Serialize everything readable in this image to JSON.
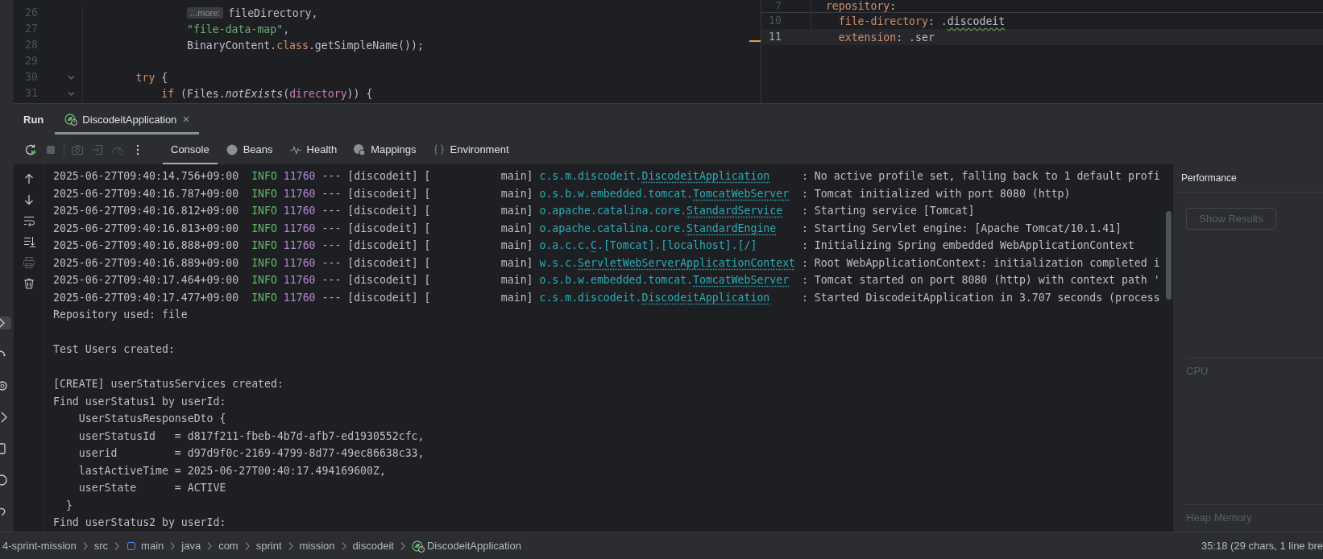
{
  "tool_strip": [
    {
      "selected": true
    },
    {
      "selected": false
    },
    {
      "selected": false
    },
    {
      "selected": false
    },
    {
      "selected": false
    },
    {
      "selected": false
    },
    {
      "selected": false
    }
  ],
  "editor_left": {
    "lines": [
      {
        "number": "26",
        "foldable": false,
        "hint": "...more:",
        "tokens": [
          {
            "kind": "plain",
            "text": "                fileDirectory,"
          }
        ]
      },
      {
        "number": "27",
        "foldable": false,
        "tokens": [
          {
            "kind": "string",
            "text": "                \"file-data-map\""
          },
          {
            "kind": "plain",
            "text": ","
          }
        ]
      },
      {
        "number": "28",
        "foldable": false,
        "tokens": [
          {
            "kind": "plain",
            "text": "                BinaryContent."
          },
          {
            "kind": "keyword",
            "text": "class"
          },
          {
            "kind": "plain",
            "text": ".getSimpleName());"
          }
        ]
      },
      {
        "number": "29",
        "foldable": false
      },
      {
        "number": "30",
        "foldable": true,
        "tokens": [
          {
            "kind": "keyword",
            "text": "        try"
          },
          {
            "kind": "plain",
            "text": " {"
          }
        ]
      },
      {
        "number": "31",
        "foldable": true,
        "tokens": [
          {
            "kind": "keyword",
            "text": "            if"
          },
          {
            "kind": "plain",
            "text": " (Files."
          },
          {
            "kind": "method",
            "text": "notExists"
          },
          {
            "kind": "plain",
            "text": "("
          },
          {
            "kind": "field",
            "text": "directory"
          },
          {
            "kind": "plain",
            "text": ")) {"
          }
        ]
      }
    ]
  },
  "editor_right": {
    "lines": [
      {
        "number": "7",
        "sticky": true,
        "current": false,
        "tokens": [
          {
            "kind": "key",
            "text": "  repository"
          },
          {
            "kind": "plain",
            "text": ":"
          }
        ]
      },
      {
        "number": "10",
        "sticky": false,
        "current": false,
        "tokens": [
          {
            "kind": "key",
            "text": "    file-directory"
          },
          {
            "kind": "plain",
            "text": ": ."
          },
          {
            "kind": "typo",
            "text": "discodeit"
          }
        ]
      },
      {
        "number": "11",
        "sticky": false,
        "current": true,
        "tokens": [
          {
            "kind": "key",
            "text": "    extension"
          },
          {
            "kind": "plain",
            "text": ": .ser"
          }
        ]
      }
    ]
  },
  "run": {
    "title": "Run",
    "tabs": [
      {
        "label": "DiscodeitApplication",
        "selected": true
      }
    ],
    "toolbar_groups": [
      {
        "items": [
          {
            "kind": "rerun",
            "disabled": false
          },
          {
            "kind": "stop",
            "disabled": true
          }
        ]
      },
      {
        "items": [
          {
            "kind": "camera",
            "disabled": true
          },
          {
            "kind": "login",
            "disabled": true
          },
          {
            "kind": "gauge",
            "disabled": true
          },
          {
            "kind": "more",
            "disabled": false
          }
        ]
      }
    ],
    "views": [
      {
        "label": "Console",
        "selected": true
      },
      {
        "label": "Beans",
        "kind": "beans",
        "selected": false
      },
      {
        "label": "Health",
        "kind": "health",
        "selected": false
      },
      {
        "label": "Mappings",
        "kind": "mappings",
        "selected": false
      },
      {
        "label": "Environment",
        "kind": "environment",
        "selected": false
      }
    ]
  },
  "console": {
    "side_tools": [
      {
        "kind": "up",
        "disabled": false
      },
      {
        "kind": "down",
        "disabled": false
      },
      {
        "kind": "wrap",
        "disabled": false
      },
      {
        "kind": "scroll_end",
        "disabled": false
      },
      {
        "kind": "print",
        "disabled": true
      },
      {
        "kind": "trash",
        "disabled": false
      }
    ],
    "lines": [
      {
        "kind": "log",
        "timestamp": "2025-06-27T09:40:14.756+09:00",
        "level": "INFO",
        "pid": "11760",
        "context": "--- [discodeit] [           main]",
        "logger_prefix": "c.s.m.discodeit.",
        "logger_class": "DiscodeitApplication",
        "message": ": No active profile set, falling back to 1 default profi"
      },
      {
        "kind": "log",
        "timestamp": "2025-06-27T09:40:16.787+09:00",
        "level": "INFO",
        "pid": "11760",
        "context": "--- [discodeit] [           main]",
        "logger_prefix": "o.s.b.w.embedded.tomcat.",
        "logger_class": "TomcatWebServer",
        "message": ": Tomcat initialized with port 8080 (http)"
      },
      {
        "kind": "log",
        "timestamp": "2025-06-27T09:40:16.812+09:00",
        "level": "INFO",
        "pid": "11760",
        "context": "--- [discodeit] [           main]",
        "logger_prefix": "o.apache.catalina.core.",
        "logger_class": "StandardService",
        "message": ": Starting service [Tomcat]"
      },
      {
        "kind": "log",
        "timestamp": "2025-06-27T09:40:16.813+09:00",
        "level": "INFO",
        "pid": "11760",
        "context": "--- [discodeit] [           main]",
        "logger_prefix": "o.apache.catalina.core.",
        "logger_class": "StandardEngine",
        "message": ": Starting Servlet engine: [Apache Tomcat/10.1.41]"
      },
      {
        "kind": "log",
        "timestamp": "2025-06-27T09:40:16.888+09:00",
        "level": "INFO",
        "pid": "11760",
        "context": "--- [discodeit] [           main]",
        "logger_prefix": "o.a.c.c.",
        "logger_class": "C",
        "logger_suffix": ".[Tomcat].[localhost].[/]",
        "message": ": Initializing Spring embedded WebApplicationContext"
      },
      {
        "kind": "log",
        "timestamp": "2025-06-27T09:40:16.889+09:00",
        "level": "INFO",
        "pid": "11760",
        "context": "--- [discodeit] [           main]",
        "logger_prefix": "w.s.c.",
        "logger_class": "ServletWebServerApplicationContext",
        "message": ": Root WebApplicationContext: initialization completed i"
      },
      {
        "kind": "log",
        "timestamp": "2025-06-27T09:40:17.464+09:00",
        "level": "INFO",
        "pid": "11760",
        "context": "--- [discodeit] [           main]",
        "logger_prefix": "o.s.b.w.embedded.tomcat.",
        "logger_class": "TomcatWebServer",
        "message": ": Tomcat started on port 8080 (http) with context path '"
      },
      {
        "kind": "log",
        "timestamp": "2025-06-27T09:40:17.477+09:00",
        "level": "INFO",
        "pid": "11760",
        "context": "--- [discodeit] [           main]",
        "logger_prefix": "c.s.m.discodeit.",
        "logger_class": "DiscodeitApplication",
        "message": ": Started DiscodeitApplication in 3.707 seconds (process"
      },
      {
        "kind": "text",
        "text": "Repository used: file"
      },
      {
        "kind": "blank"
      },
      {
        "kind": "text",
        "text": "Test Users created:"
      },
      {
        "kind": "blank"
      },
      {
        "kind": "text",
        "text": "[CREATE] userStatusServices created:"
      },
      {
        "kind": "text",
        "text": "Find userStatus1 by userId:"
      },
      {
        "kind": "text",
        "text": "    UserStatusResponseDto {"
      },
      {
        "kind": "text",
        "text": "    userStatusId   = d817f211-fbeb-4b7d-afb7-ed1930552cfc,"
      },
      {
        "kind": "text",
        "text": "    userid         = d97d9f0c-2169-4799-8d77-49ec86638c33,"
      },
      {
        "kind": "text",
        "text": "    lastActiveTime = 2025-06-27T00:40:17.494169600Z,"
      },
      {
        "kind": "text",
        "text": "    userState      = ACTIVE"
      },
      {
        "kind": "text",
        "text": "  }"
      },
      {
        "kind": "text",
        "text": "Find userStatus2 by userId:"
      }
    ]
  },
  "performance": {
    "title": "Performance",
    "button": {
      "label": "Show Results",
      "disabled": true
    },
    "sections": [
      {
        "label": "CPU"
      },
      {
        "label": "Heap Memory"
      }
    ]
  },
  "status_bar": {
    "breadcrumbs": [
      {
        "label": "4-sprint-mission"
      },
      {
        "label": "src"
      },
      {
        "label": "main",
        "kind": "module"
      },
      {
        "label": "java"
      },
      {
        "label": "com"
      },
      {
        "label": "sprint"
      },
      {
        "label": "mission"
      },
      {
        "label": "discodeit"
      },
      {
        "label": "DiscodeitApplication",
        "kind": "spring_app"
      }
    ],
    "position": "35:18 (29 chars, 1 line bre"
  }
}
